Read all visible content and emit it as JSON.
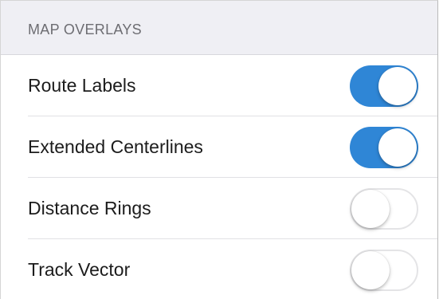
{
  "section": {
    "title": "MAP OVERLAYS"
  },
  "rows": [
    {
      "label": "Route Labels",
      "on": true
    },
    {
      "label": "Extended Centerlines",
      "on": true
    },
    {
      "label": "Distance Rings",
      "on": false
    },
    {
      "label": "Track Vector",
      "on": false
    }
  ],
  "colors": {
    "toggle_on": "#2f86d6",
    "toggle_off_border": "#e4e4e6",
    "header_bg": "#efeff4"
  }
}
